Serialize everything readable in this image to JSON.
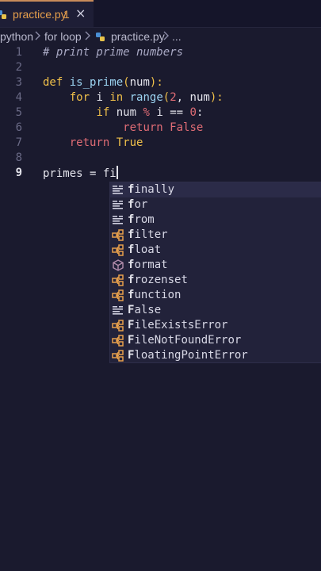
{
  "tab": {
    "filename": "practice.py",
    "problems": "1",
    "close": "×"
  },
  "breadcrumb": {
    "folder1": "python",
    "folder2": "for loop",
    "file": "practice.py",
    "more": "..."
  },
  "editor": {
    "line_numbers": [
      "1",
      "2",
      "3",
      "4",
      "5",
      "6",
      "7",
      "8",
      "9"
    ],
    "active_line": "9",
    "lines": {
      "l1": {
        "comment": "# print prime numbers"
      },
      "l3": {
        "def": "def",
        "name": "is_prime",
        "open": "(",
        "param": "num",
        "close": "):"
      },
      "l4": {
        "for": "for",
        "var": "i",
        "in": "in",
        "range": "range",
        "open": "(",
        "start": "2",
        "comma": ", ",
        "end": "num",
        "close": "):"
      },
      "l5": {
        "if": "if",
        "lhs": "num",
        "op": "%",
        "var": "i",
        "eq": "==",
        "zero": "0",
        "colon": ":"
      },
      "l6": {
        "return": "return",
        "value": "False"
      },
      "l7": {
        "return": "return",
        "value": "True"
      },
      "l9": {
        "text": "primes = fi"
      }
    }
  },
  "suggestions": {
    "typed": "f",
    "items": [
      {
        "match": "f",
        "rest": "inally",
        "icon": "keyword-icon"
      },
      {
        "match": "f",
        "rest": "or",
        "icon": "keyword-icon"
      },
      {
        "match": "f",
        "rest": "rom",
        "icon": "keyword-icon"
      },
      {
        "match": "f",
        "rest": "ilter",
        "icon": "class-icon"
      },
      {
        "match": "f",
        "rest": "loat",
        "icon": "class-icon"
      },
      {
        "match": "f",
        "rest": "ormat",
        "icon": "function-icon"
      },
      {
        "match": "f",
        "rest": "rozenset",
        "icon": "class-icon"
      },
      {
        "match": "f",
        "rest": "unction",
        "icon": "class-icon"
      },
      {
        "match": "F",
        "rest": "alse",
        "icon": "keyword-icon"
      },
      {
        "match": "F",
        "rest": "ileExistsError",
        "icon": "class-icon"
      },
      {
        "match": "F",
        "rest": "ileNotFoundError",
        "icon": "class-icon"
      },
      {
        "match": "F",
        "rest": "loatingPointError",
        "icon": "class-icon"
      }
    ]
  },
  "colors": {
    "keyword": "#f0c04a",
    "function": "#9cd4f2",
    "number": "#e06c75",
    "tab_accent": "#e8a04c",
    "class_icon": "#e8a04c",
    "function_icon": "#b48ead"
  }
}
